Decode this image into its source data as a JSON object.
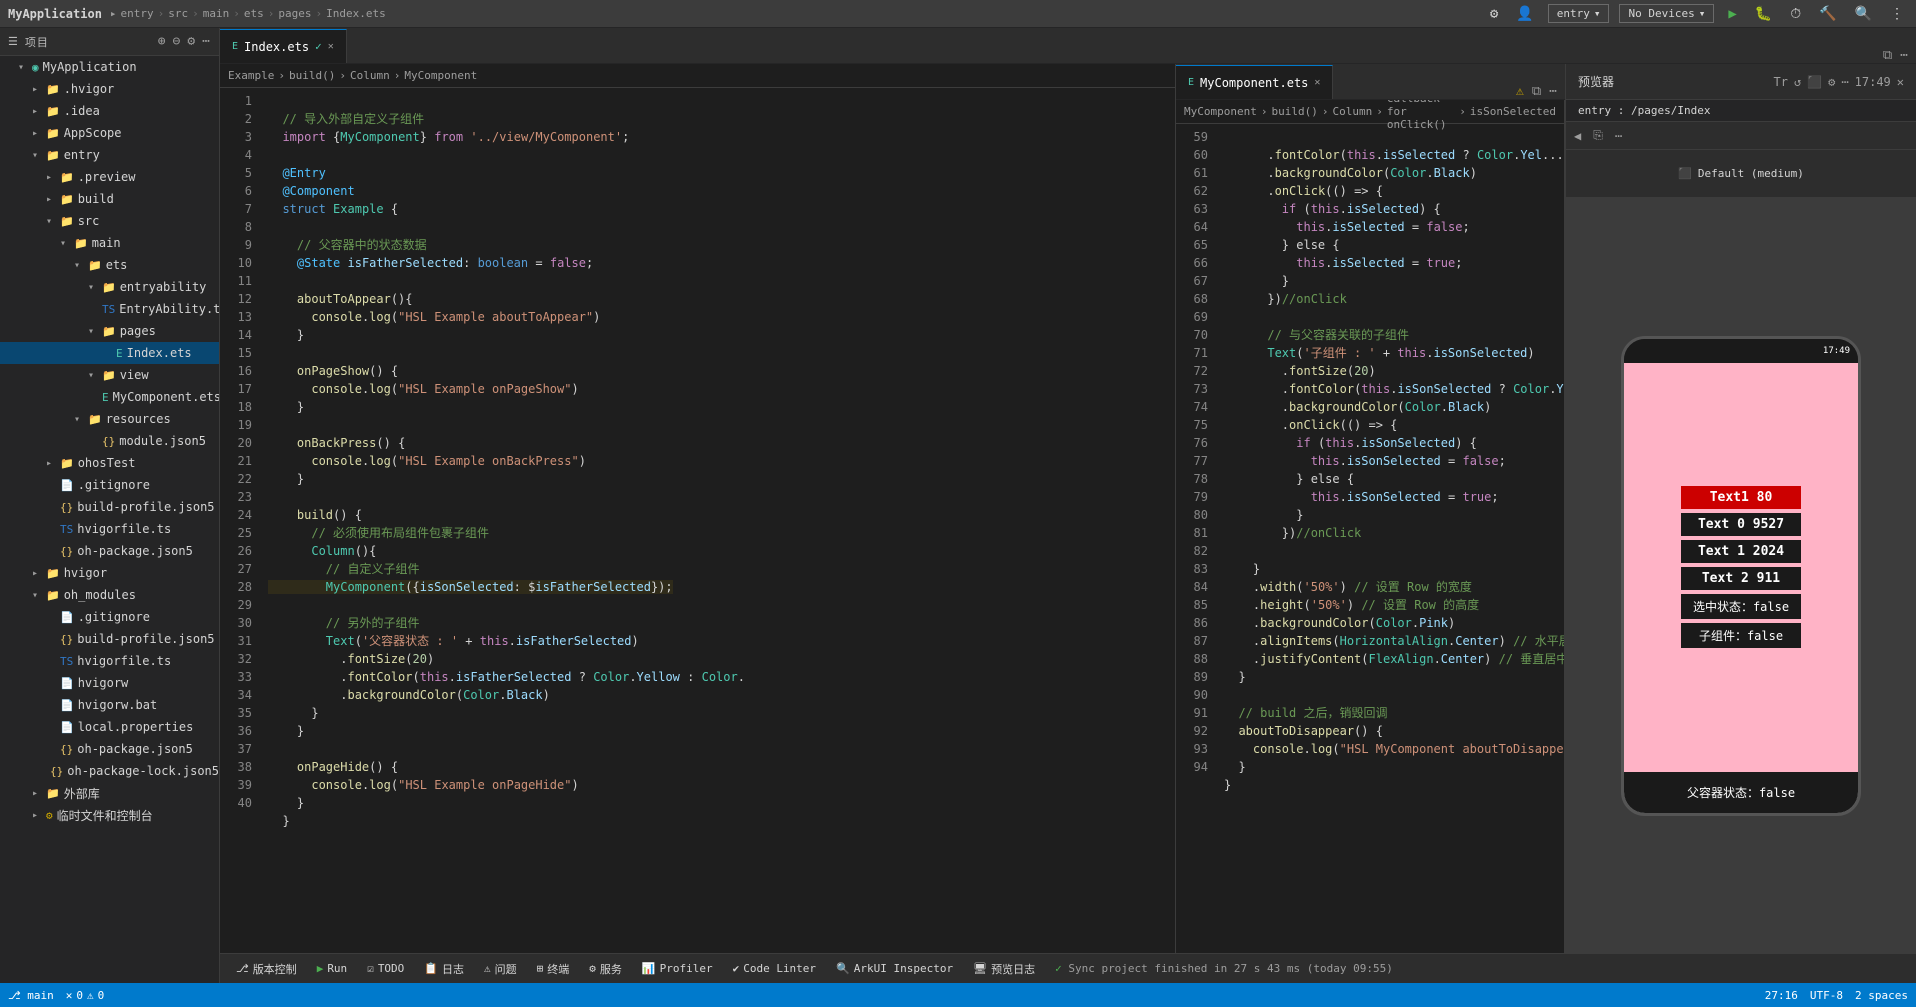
{
  "app": {
    "title": "MyApplication",
    "breadcrumbs": [
      "entry",
      "src",
      "main",
      "ets",
      "pages",
      "Index.ets"
    ],
    "tab_file1": "Index.ets",
    "tab_file2": "MyComponent.ets"
  },
  "topbar": {
    "title": "MyApplication",
    "entry_label": "entry",
    "no_devices": "No Devices",
    "devices_label": "Devices"
  },
  "sidebar": {
    "header": "MyApplication",
    "items": [
      {
        "label": ".hvigor",
        "indent": 1,
        "type": "folder",
        "expanded": false
      },
      {
        "label": ".idea",
        "indent": 1,
        "type": "folder",
        "expanded": false
      },
      {
        "label": "AppScope",
        "indent": 1,
        "type": "folder",
        "expanded": false
      },
      {
        "label": "entry",
        "indent": 1,
        "type": "folder",
        "expanded": true
      },
      {
        "label": ".preview",
        "indent": 2,
        "type": "folder",
        "expanded": false
      },
      {
        "label": "build",
        "indent": 2,
        "type": "folder",
        "expanded": false
      },
      {
        "label": "src",
        "indent": 2,
        "type": "folder",
        "expanded": true
      },
      {
        "label": "main",
        "indent": 3,
        "type": "folder",
        "expanded": true
      },
      {
        "label": "ets",
        "indent": 4,
        "type": "folder",
        "expanded": true
      },
      {
        "label": "entryability",
        "indent": 5,
        "type": "folder",
        "expanded": true
      },
      {
        "label": "EntryAbility.ts",
        "indent": 6,
        "type": "file-ts"
      },
      {
        "label": "pages",
        "indent": 5,
        "type": "folder",
        "expanded": true
      },
      {
        "label": "Index.ets",
        "indent": 6,
        "type": "file-ets",
        "active": true
      },
      {
        "label": "view",
        "indent": 5,
        "type": "folder",
        "expanded": true
      },
      {
        "label": "MyComponent.ets",
        "indent": 6,
        "type": "file-ets"
      },
      {
        "label": "resources",
        "indent": 4,
        "type": "folder",
        "expanded": true
      },
      {
        "label": "module.json5",
        "indent": 5,
        "type": "file-json"
      },
      {
        "label": "ohosTest",
        "indent": 2,
        "type": "folder",
        "expanded": false
      },
      {
        "label": ".gitignore",
        "indent": 2,
        "type": "file"
      },
      {
        "label": "build-profile.json5",
        "indent": 2,
        "type": "file-json"
      },
      {
        "label": "hvigorfile.ts",
        "indent": 2,
        "type": "file-ts"
      },
      {
        "label": "oh-package.json5",
        "indent": 2,
        "type": "file-json"
      },
      {
        "label": "hvigor",
        "indent": 1,
        "type": "folder",
        "expanded": false
      },
      {
        "label": "oh_modules",
        "indent": 1,
        "type": "folder",
        "expanded": true
      },
      {
        "label": ".gitignore",
        "indent": 2,
        "type": "file"
      },
      {
        "label": "build-profile.json5",
        "indent": 2,
        "type": "file-json"
      },
      {
        "label": "hvigorfile.ts",
        "indent": 2,
        "type": "file-ts"
      },
      {
        "label": "hvigorw",
        "indent": 2,
        "type": "file"
      },
      {
        "label": "hvigorw.bat",
        "indent": 2,
        "type": "file"
      },
      {
        "label": "local.properties",
        "indent": 2,
        "type": "file"
      },
      {
        "label": "oh-package.json5",
        "indent": 2,
        "type": "file-json"
      },
      {
        "label": "oh-package-lock.json5",
        "indent": 2,
        "type": "file-json"
      },
      {
        "label": "外部库",
        "indent": 1,
        "type": "folder",
        "expanded": false
      },
      {
        "label": "临时文件和控制台",
        "indent": 1,
        "type": "folder",
        "expanded": false
      }
    ]
  },
  "editor1": {
    "filename": "Index.ets",
    "breadcrumb": "Example > build() > Column > MyComponent",
    "lines": [
      {
        "n": 1,
        "code": "  // 导入外部自定义子组件"
      },
      {
        "n": 2,
        "code": "  import {MyComponent} from '../view/MyComponent';"
      },
      {
        "n": 3,
        "code": ""
      },
      {
        "n": 4,
        "code": "  @Entry"
      },
      {
        "n": 5,
        "code": "  @Component"
      },
      {
        "n": 6,
        "code": "  struct Example {"
      },
      {
        "n": 7,
        "code": ""
      },
      {
        "n": 8,
        "code": "    // 父容器中的状态数据"
      },
      {
        "n": 9,
        "code": "    @State isFatherSelected: boolean = false;"
      },
      {
        "n": 10,
        "code": ""
      },
      {
        "n": 11,
        "code": "    aboutToAppear(){"
      },
      {
        "n": 12,
        "code": "      console.log(\"HSL Example aboutToAppear\")"
      },
      {
        "n": 13,
        "code": "    }"
      },
      {
        "n": 14,
        "code": ""
      },
      {
        "n": 15,
        "code": "    onPageShow() {"
      },
      {
        "n": 16,
        "code": "      console.log(\"HSL Example onPageShow\")"
      },
      {
        "n": 17,
        "code": "    }"
      },
      {
        "n": 18,
        "code": ""
      },
      {
        "n": 19,
        "code": "    onBackPress() {"
      },
      {
        "n": 20,
        "code": "      console.log(\"HSL Example onBackPress\")"
      },
      {
        "n": 21,
        "code": "    }"
      },
      {
        "n": 22,
        "code": ""
      },
      {
        "n": 23,
        "code": "    build() {"
      },
      {
        "n": 24,
        "code": "      // 必须使用布局组件包裹子组件"
      },
      {
        "n": 25,
        "code": "      Column(){"
      },
      {
        "n": 26,
        "code": "        // 自定义子组件"
      },
      {
        "n": 27,
        "code": "        MyComponent({isSonSelected: $isFatherSelected});",
        "warn": true
      },
      {
        "n": 28,
        "code": ""
      },
      {
        "n": 29,
        "code": "        // 另外的子组件"
      },
      {
        "n": 30,
        "code": "        Text('父容器状态 : ' + this.isFatherSelected)"
      },
      {
        "n": 31,
        "code": "          .fontSize(20)"
      },
      {
        "n": 32,
        "code": "          .fontColor(this.isFatherSelected ? Color.Yellow : Color."
      },
      {
        "n": 33,
        "code": "          .backgroundColor(Color.Black)"
      },
      {
        "n": 34,
        "code": "      }"
      },
      {
        "n": 35,
        "code": "    }"
      },
      {
        "n": 36,
        "code": ""
      },
      {
        "n": 37,
        "code": "    onPageHide() {"
      },
      {
        "n": 38,
        "code": "      console.log(\"HSL Example onPageHide\")"
      },
      {
        "n": 39,
        "code": "    }"
      },
      {
        "n": 40,
        "code": "  }"
      }
    ]
  },
  "editor2": {
    "filename": "MyComponent.ets",
    "breadcrumb": "MyComponent > build() > Column > callback for onClick() > isSonSelected",
    "lines": [
      {
        "n": 59,
        "code": "    .fontColor(this.isSelected ? Color.Yel..."
      },
      {
        "n": 60,
        "code": "    .backgroundColor(Color.Black)"
      },
      {
        "n": 61,
        "code": "    .onClick(() => {"
      },
      {
        "n": 62,
        "code": "      if (this.isSelected) {"
      },
      {
        "n": 63,
        "code": "        this.isSelected = false;"
      },
      {
        "n": 64,
        "code": "      } else {"
      },
      {
        "n": 65,
        "code": "        this.isSelected = true;"
      },
      {
        "n": 66,
        "code": "      }"
      },
      {
        "n": 67,
        "code": "    })//onClick"
      },
      {
        "n": 68,
        "code": ""
      },
      {
        "n": 69,
        "code": "    // 与父容器关联的子组件"
      },
      {
        "n": 70,
        "code": "    Text('子组件 : ' + this.isSonSelected)"
      },
      {
        "n": 71,
        "code": "      .fontSize(20)"
      },
      {
        "n": 72,
        "code": "      .fontColor(this.isSonSelected ? Color.Yellow : C"
      },
      {
        "n": 73,
        "code": "      .backgroundColor(Color.Black)"
      },
      {
        "n": 74,
        "code": "      .onClick(() => {"
      },
      {
        "n": 75,
        "code": "        if (this.isSonSelected) {"
      },
      {
        "n": 76,
        "code": "          this.isSonSelected = false;"
      },
      {
        "n": 77,
        "code": "        } else {"
      },
      {
        "n": 78,
        "code": "          this.isSonSelected = true;"
      },
      {
        "n": 79,
        "code": "        }"
      },
      {
        "n": 80,
        "code": "      })//onClick"
      },
      {
        "n": 81,
        "code": ""
      },
      {
        "n": 82,
        "code": "    }"
      },
      {
        "n": 83,
        "code": "    .width('50%') // 设置 Row 的宽度"
      },
      {
        "n": 84,
        "code": "    .height('50%') // 设置 Row 的高度"
      },
      {
        "n": 85,
        "code": "    .backgroundColor(Color.Pink)"
      },
      {
        "n": 86,
        "code": "    .alignItems(HorizontalAlign.Center) // 水平居中"
      },
      {
        "n": 87,
        "code": "    .justifyContent(FlexAlign.Center) // 垂直居中"
      },
      {
        "n": 88,
        "code": "  }"
      },
      {
        "n": 89,
        "code": ""
      },
      {
        "n": 90,
        "code": "  // build 之后，销毁回调"
      },
      {
        "n": 91,
        "code": "  aboutToDisappear() {"
      },
      {
        "n": 92,
        "code": "    console.log(\"HSL MyComponent aboutToDisappear\")"
      },
      {
        "n": 93,
        "code": "  }"
      },
      {
        "n": 94,
        "code": "}"
      }
    ]
  },
  "preview": {
    "title": "预览器",
    "path": "entry : /pages/Index",
    "device": "Default (medium)",
    "texts": {
      "text1": "Text1 80",
      "text0": "Text 0 9527",
      "text2": "Text 1 2024",
      "text3": "Text 2 911",
      "selected_state": "选中状态：false",
      "son_component": "子组件：false",
      "father_state": "父容器状态：false"
    }
  },
  "bottom_toolbar": {
    "version_control": "版本控制",
    "run": "Run",
    "todo": "TODO",
    "log": "日志",
    "issues": "问题",
    "result": "终端",
    "services": "服务",
    "profiler": "Profiler",
    "code_linter": "Code Linter",
    "arkui_inspector": "ArkUI Inspector",
    "preview_log": "预览日志"
  },
  "status_bar": {
    "sync_msg": "Sync project finished in 27 s 43 ms (today 09:55)",
    "position": "27:16",
    "encoding": "UTF-8",
    "indent": "2 spaces"
  }
}
